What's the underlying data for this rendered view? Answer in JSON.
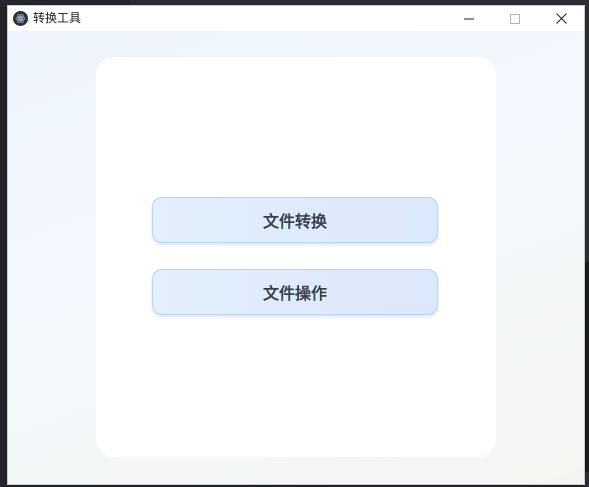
{
  "window": {
    "title": "转换工具"
  },
  "controls": {
    "minimize_icon": "minimize-icon",
    "maximize_icon": "maximize-icon",
    "close_icon": "close-icon"
  },
  "main": {
    "buttons": [
      {
        "label": "文件转换"
      },
      {
        "label": "文件操作"
      }
    ]
  },
  "colors": {
    "button_bg": "#e2effc",
    "button_border": "#bcd2f0",
    "card_bg": "#ffffff",
    "button_text": "#3a3f4a"
  }
}
